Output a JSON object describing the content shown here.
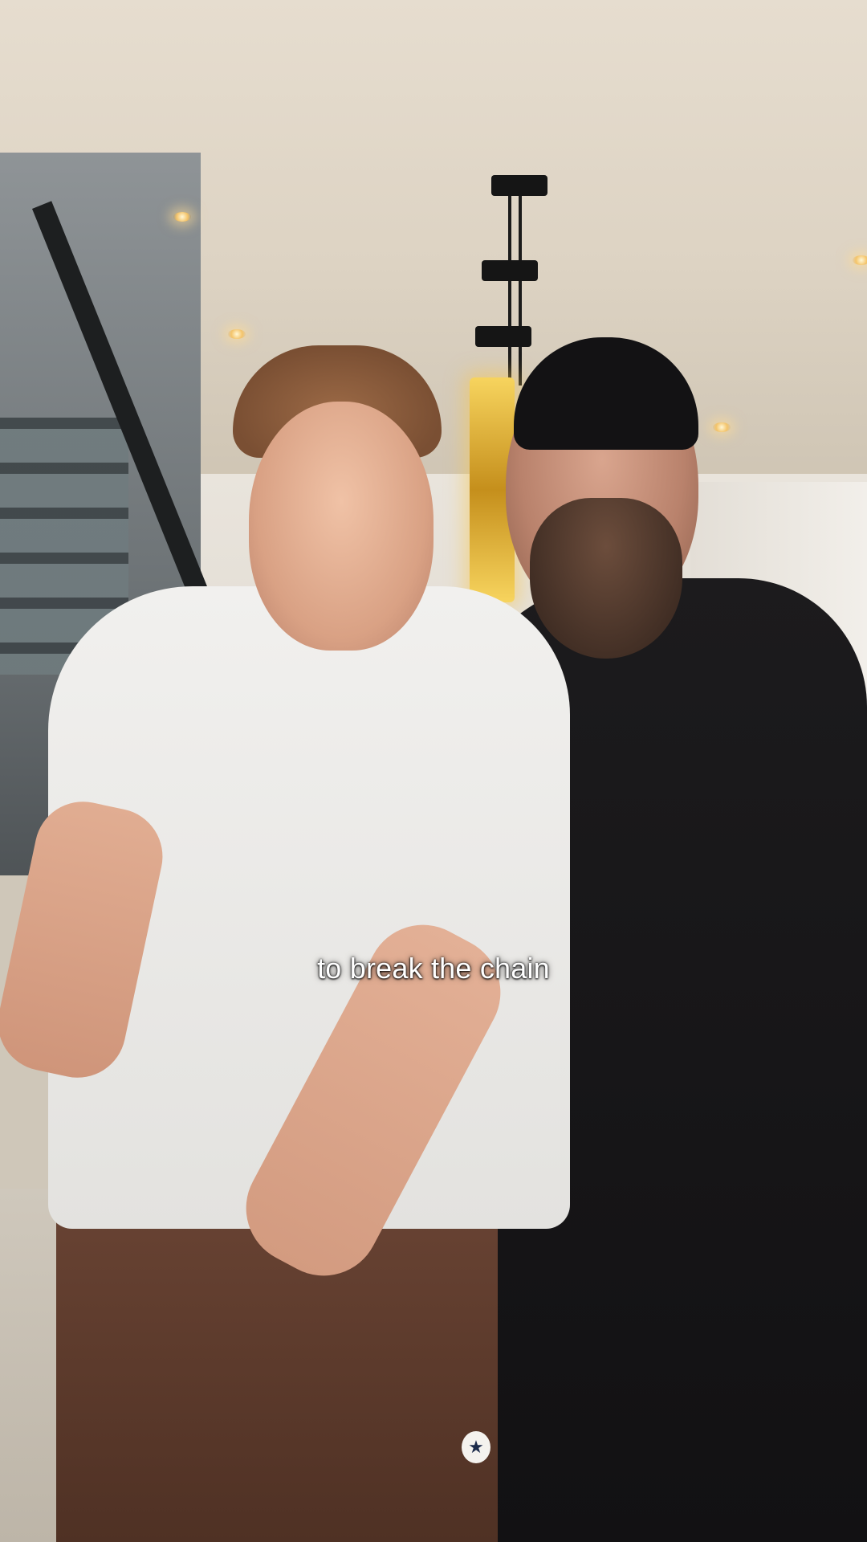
{
  "video": {
    "caption": "to break the chain"
  },
  "colors": {
    "caption_text": "#ffffff",
    "pendant_glow": "#f7d45e"
  },
  "scene_icons": {
    "pants_logo": "converse-star-icon"
  }
}
